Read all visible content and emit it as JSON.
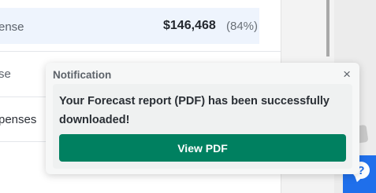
{
  "table": {
    "rows": [
      {
        "label": "ense",
        "amount": "$146,468",
        "percent": "(84%)"
      },
      {
        "label": "se"
      },
      {
        "label": "penses"
      }
    ]
  },
  "notification": {
    "title": "Notification",
    "close_label": "×",
    "message": "Your Forecast report (PDF) has been successfully downloaded!",
    "button_label": "View PDF"
  },
  "help": {
    "icon_glyph": "?"
  },
  "colors": {
    "primary_button": "#008060",
    "help_button": "#1f6feb",
    "row_highlight": "#eef4fd"
  }
}
